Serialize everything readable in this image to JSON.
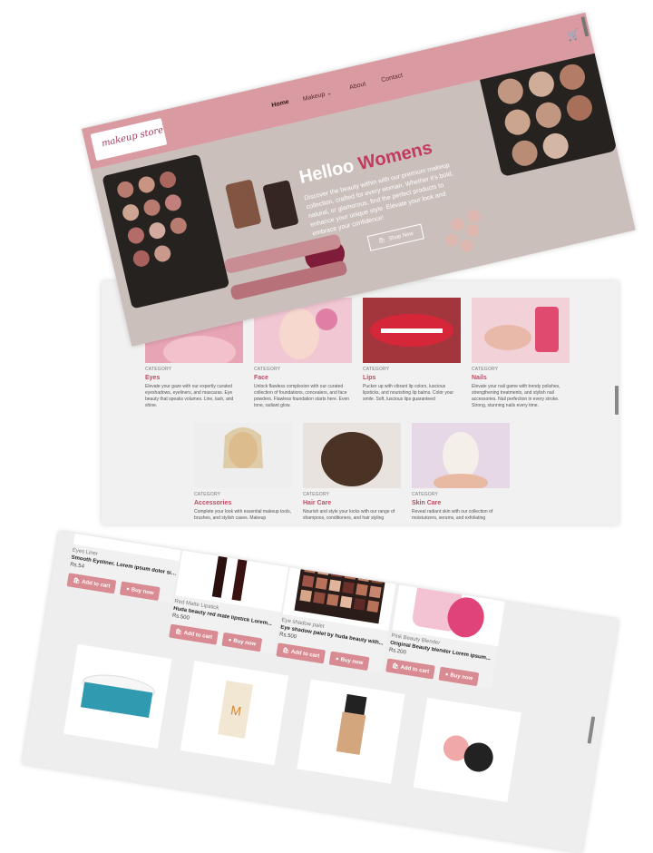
{
  "hero": {
    "logo_text": "makeup store",
    "nav": {
      "home": "Home",
      "makeup": "Makeup",
      "about": "About",
      "contact": "Contact"
    },
    "title_main": "Helloo ",
    "title_accent": "Womens",
    "description": "Discover the beauty within with our premium makeup collection, crafted for every woman. Whether it's bold, natural, or glamorous, find the perfect products to enhance your unique style. Elevate your look and embrace your confidence!",
    "cta": "Shop Now"
  },
  "categories": [
    {
      "eyebrow": "CATEGORY",
      "title": "Eyes",
      "desc": "Elevate your gaze with our expertly curated eyeshadows, eyeliners, and mascaras. Eye beauty that speaks volumes. Line, lash, and shine."
    },
    {
      "eyebrow": "CATEGORY",
      "title": "Face",
      "desc": "Unlock flawless complexion with our curated collection of foundations, concealers, and face powders. Flawless foundation starts here. Even tone, radiant glow."
    },
    {
      "eyebrow": "CATEGORY",
      "title": "Lips",
      "desc": "Pucker up with vibrant lip colors, luscious lipsticks, and nourishing lip balms. Color your smile. Soft, luscious lips guaranteed"
    },
    {
      "eyebrow": "CATEGORY",
      "title": "Nails",
      "desc": "Elevate your nail game with trendy polishes, strengthening treatments, and stylish nail accessories. Nail perfection in every stroke. Strong, stunning nails every time."
    },
    {
      "eyebrow": "CATEGORY",
      "title": "Accessories",
      "desc": "Complete your look with essential makeup tools, brushes, and stylish cases. Makeup"
    },
    {
      "eyebrow": "CATEGORY",
      "title": "Hair Care",
      "desc": "Nourish and style your locks with our range of shampoos, conditioners, and hair styling"
    },
    {
      "eyebrow": "CATEGORY",
      "title": "Skin Care",
      "desc": "Reveal radiant skin with our collection of moisturizers, serums, and exfoliating"
    }
  ],
  "products": [
    {
      "category": "Eyes Liner",
      "name": "Smooth Eyeliner. Lorem ipsum dolor sit...",
      "price": "Rs.54"
    },
    {
      "category": "Red Matte Lipstick",
      "name": "Huda beauty red mate lipstick Lorem...",
      "price": "Rs.500"
    },
    {
      "category": "Eye shadow palet",
      "name": "Eye shadow palet by huda beauty with...",
      "price": "Rs.500"
    },
    {
      "category": "Pink Beauty Blender",
      "name": "Original Beauty blender Lorem ipsum...",
      "price": "Rs.200"
    }
  ],
  "product_buttons": {
    "add": "Add to cart",
    "buy": "Buy now"
  },
  "colors": {
    "brand_pink": "#d99aa1",
    "accent_magenta": "#c23a5c",
    "button_pink": "#d98b93"
  }
}
